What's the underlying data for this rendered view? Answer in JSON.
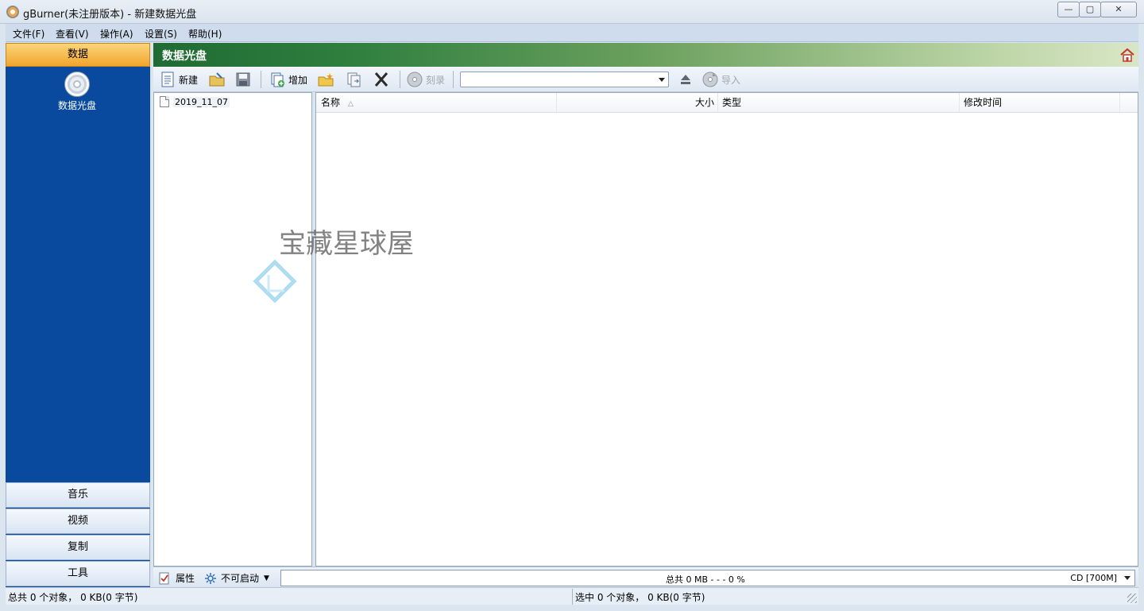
{
  "window": {
    "title": "gBurner(未注册版本) - 新建数据光盘",
    "btn_min": "—",
    "btn_max": "▢",
    "btn_close": "✕"
  },
  "menu": {
    "file": "文件(F)",
    "view": "查看(V)",
    "action": "操作(A)",
    "settings": "设置(S)",
    "help": "帮助(H)"
  },
  "sidebar": {
    "header": "数据",
    "item_label": "数据光盘",
    "tabs": [
      "音乐",
      "视频",
      "复制",
      "工具"
    ]
  },
  "panel": {
    "title": "数据光盘"
  },
  "toolbar": {
    "new_label": "新建",
    "add_label": "增加",
    "burn_label": "刻录",
    "import_label": "导入",
    "drive_value": ""
  },
  "tree": {
    "node_label": "2019_11_07"
  },
  "list": {
    "columns": [
      "名称",
      "大小",
      "类型",
      "修改时间"
    ],
    "sort_indicator": "△"
  },
  "watermark": {
    "text": "宝藏星球屋"
  },
  "bottom": {
    "properties_label": "属性",
    "boot_label": "不可启动",
    "capacity_text": "总共 0 MB   - - -  0 %",
    "disc_type": "CD [700M]"
  },
  "status": {
    "left": "总共 0 个对象， 0 KB(0 字节)",
    "right": "选中 0 个对象， 0 KB(0 字节)"
  },
  "colors": {
    "sidebar_bg": "#0a4a9e",
    "header_accent": "#f1a52c",
    "panel_green": "#2f7f3f"
  }
}
